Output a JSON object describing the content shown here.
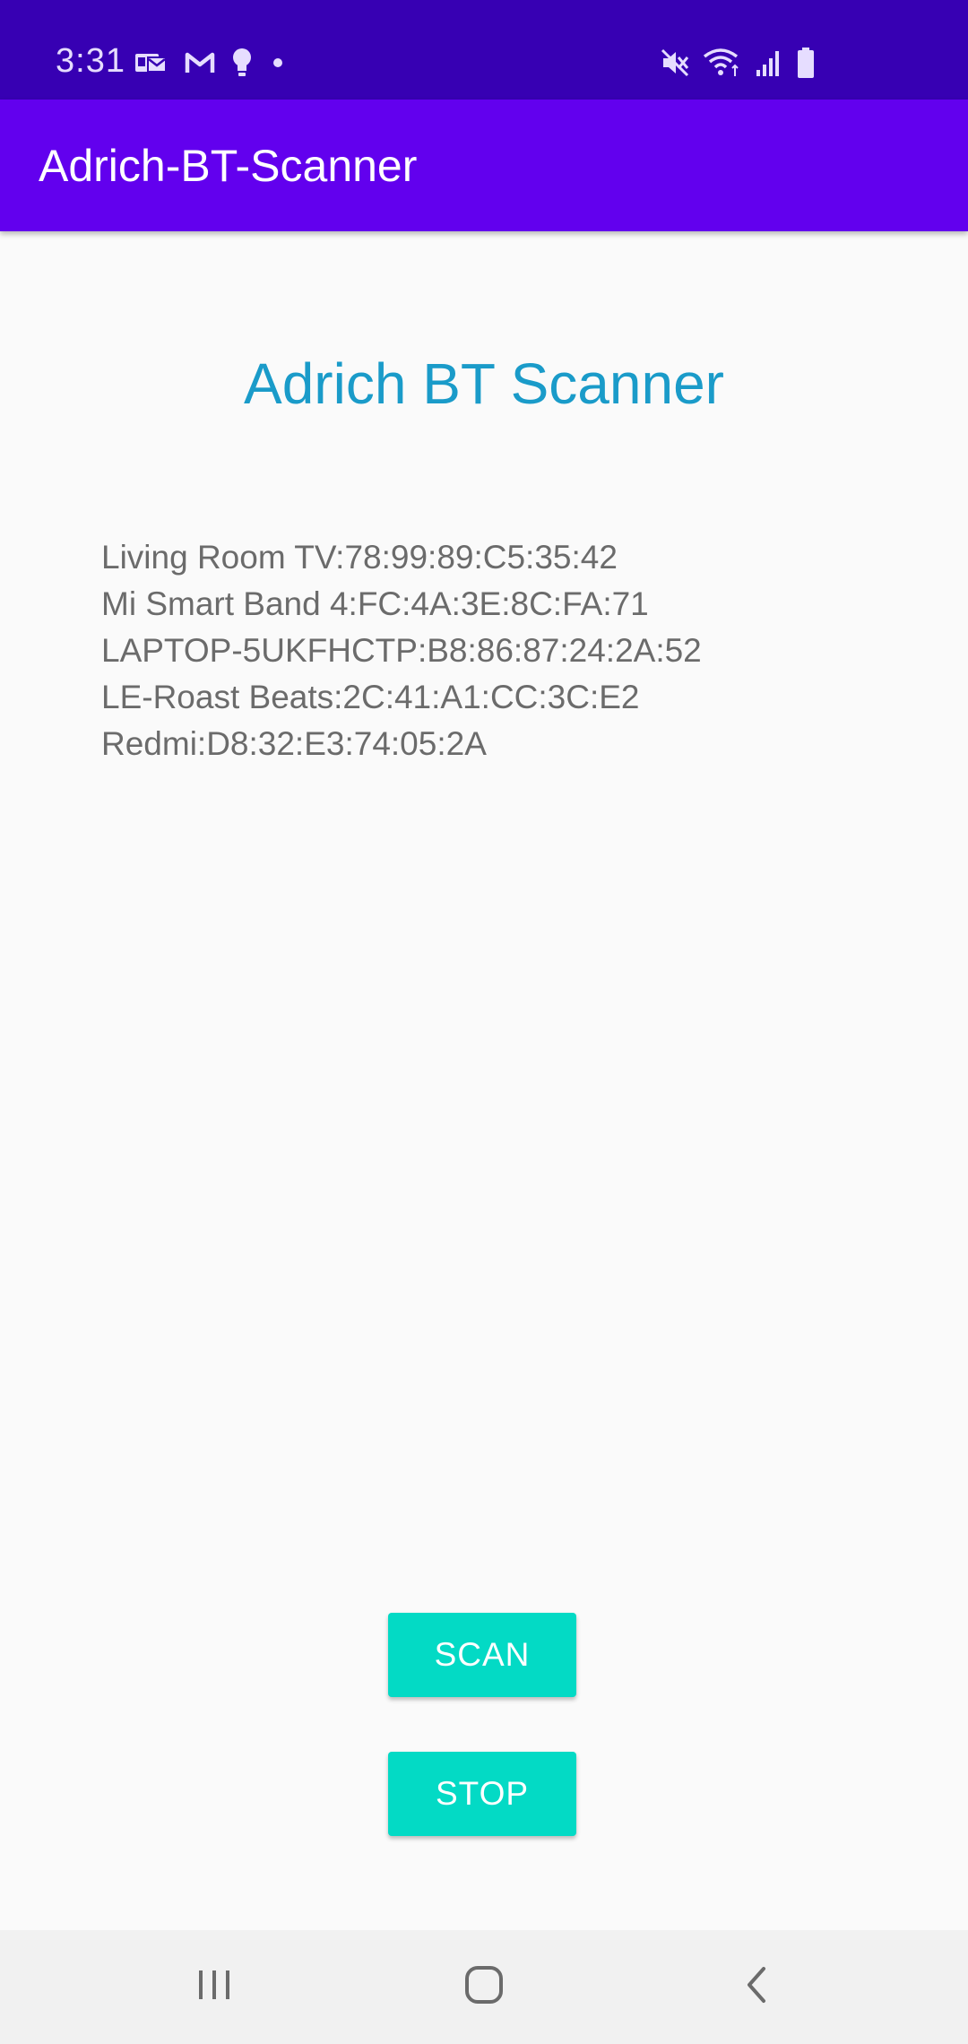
{
  "status_bar": {
    "time": "3:31",
    "left_icons": [
      "email-icon",
      "gmail-icon",
      "bulb-icon",
      "dot-icon"
    ],
    "right_icons": [
      "mute-icon",
      "wifi-icon",
      "signal-icon",
      "battery-icon"
    ]
  },
  "app_bar": {
    "title": "Adrich-BT-Scanner"
  },
  "main": {
    "heading": "Adrich BT Scanner",
    "devices": [
      "Living Room TV:78:99:89:C5:35:42",
      "Mi Smart Band 4:FC:4A:3E:8C:FA:71",
      "LAPTOP-5UKFHCTP:B8:86:87:24:2A:52",
      "LE-Roast Beats:2C:41:A1:CC:3C:E2",
      "Redmi:D8:32:E3:74:05:2A"
    ],
    "scan_button": "SCAN",
    "stop_button": "STOP"
  },
  "nav_bar": {
    "icons": [
      "recents-icon",
      "home-icon",
      "back-icon"
    ]
  },
  "colors": {
    "status_bar": "#3700b3",
    "app_bar": "#6200ee",
    "heading": "#1a9bc9",
    "button": "#03dac5"
  }
}
